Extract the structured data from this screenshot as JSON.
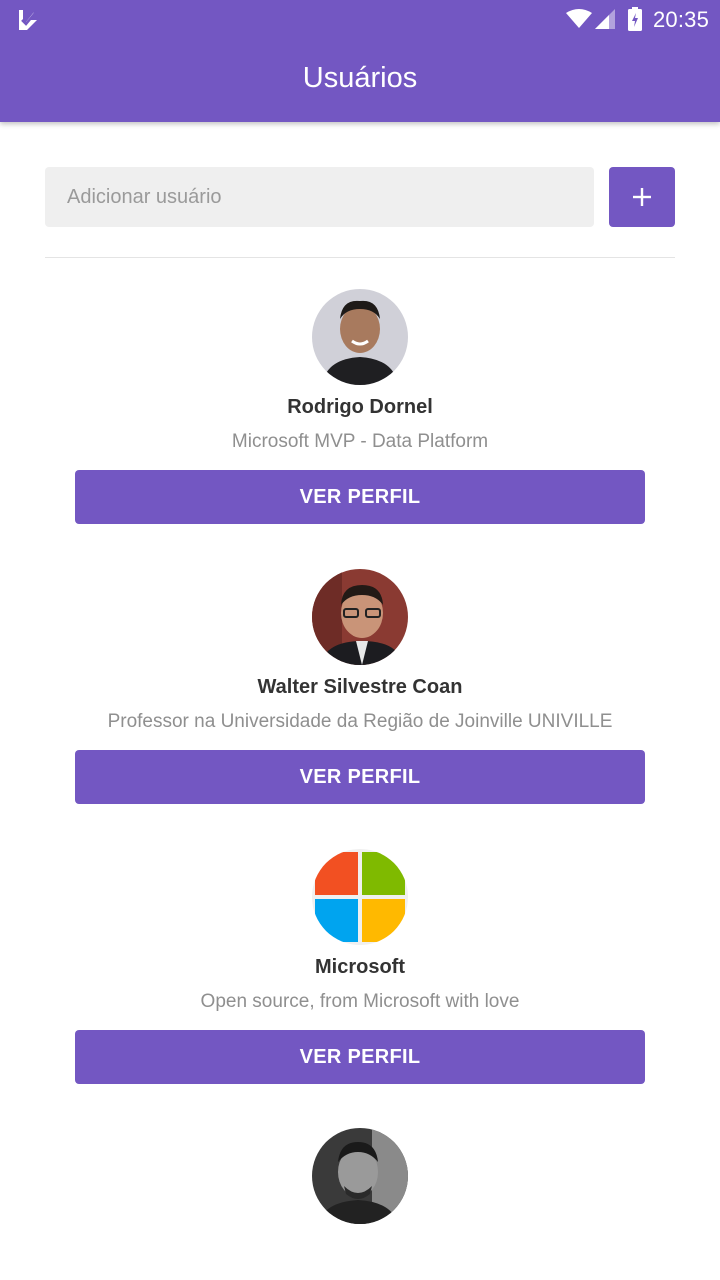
{
  "status_bar": {
    "time": "20:35",
    "icons": [
      "app-notification-icon",
      "wifi-icon",
      "signal-icon",
      "battery-charging-icon"
    ]
  },
  "header": {
    "title": "Usuários",
    "background_color": "#7357c2"
  },
  "add_user": {
    "placeholder": "Adicionar usuário",
    "value": "",
    "button_icon": "plus-icon"
  },
  "users": [
    {
      "name": "Rodrigo Dornel",
      "bio": "Microsoft MVP - Data Platform",
      "button_label": "VER PERFIL",
      "avatar": "person-photo"
    },
    {
      "name": "Walter Silvestre Coan",
      "bio": "Professor na Universidade da Região de Joinville UNIVILLE",
      "button_label": "VER PERFIL",
      "avatar": "person-photo"
    },
    {
      "name": "Microsoft",
      "bio": "Open source, from Microsoft with love",
      "button_label": "VER PERFIL",
      "avatar": "microsoft-logo"
    },
    {
      "name": "",
      "bio": "",
      "button_label": "",
      "avatar": "person-photo-grayscale"
    }
  ],
  "colors": {
    "accent": "#7357c2",
    "name_text": "#333333",
    "bio_text": "#8f8f8f",
    "input_bg": "#efefef"
  }
}
